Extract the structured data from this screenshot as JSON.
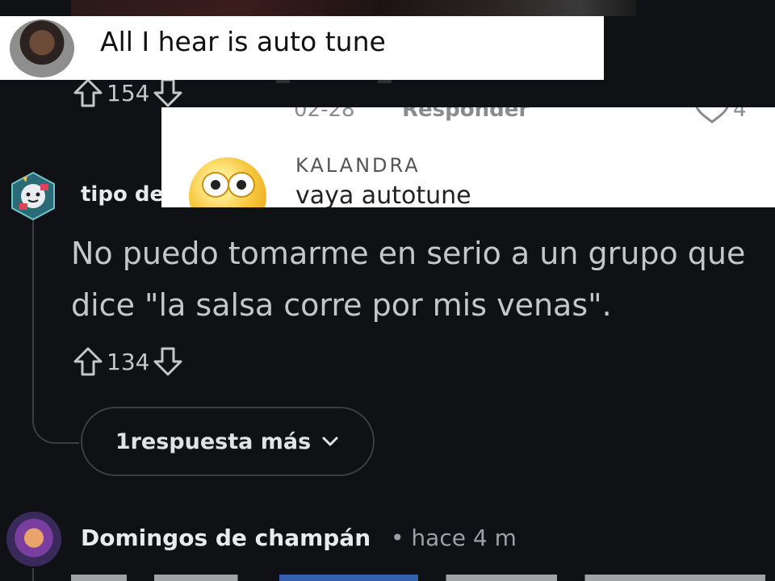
{
  "overlay_card_1": {
    "comment": "All I hear is auto tune"
  },
  "vote_row_1": {
    "upvotes": "154"
  },
  "overlay_card_2": {
    "date": "02-28",
    "reply_label": "Responder",
    "likes": "4",
    "username": "KALANDRA",
    "comment": "vaya autotune"
  },
  "comment_tipo": {
    "username": "tipo de",
    "body": "No puedo tomarme en serio a un grupo que dice \"la salsa corre por mis venas\".",
    "upvotes": "134"
  },
  "more_replies": {
    "label": "1respuesta más",
    "icon": "chevron-down-icon"
  },
  "comment_domingos": {
    "username": "Domingos de champán",
    "separator": "•",
    "time": "hace 4 m"
  },
  "colors": {
    "background": "#0f1114",
    "text": "#c4c7c9",
    "border": "#3a3d42",
    "link": "#3d74d6"
  }
}
